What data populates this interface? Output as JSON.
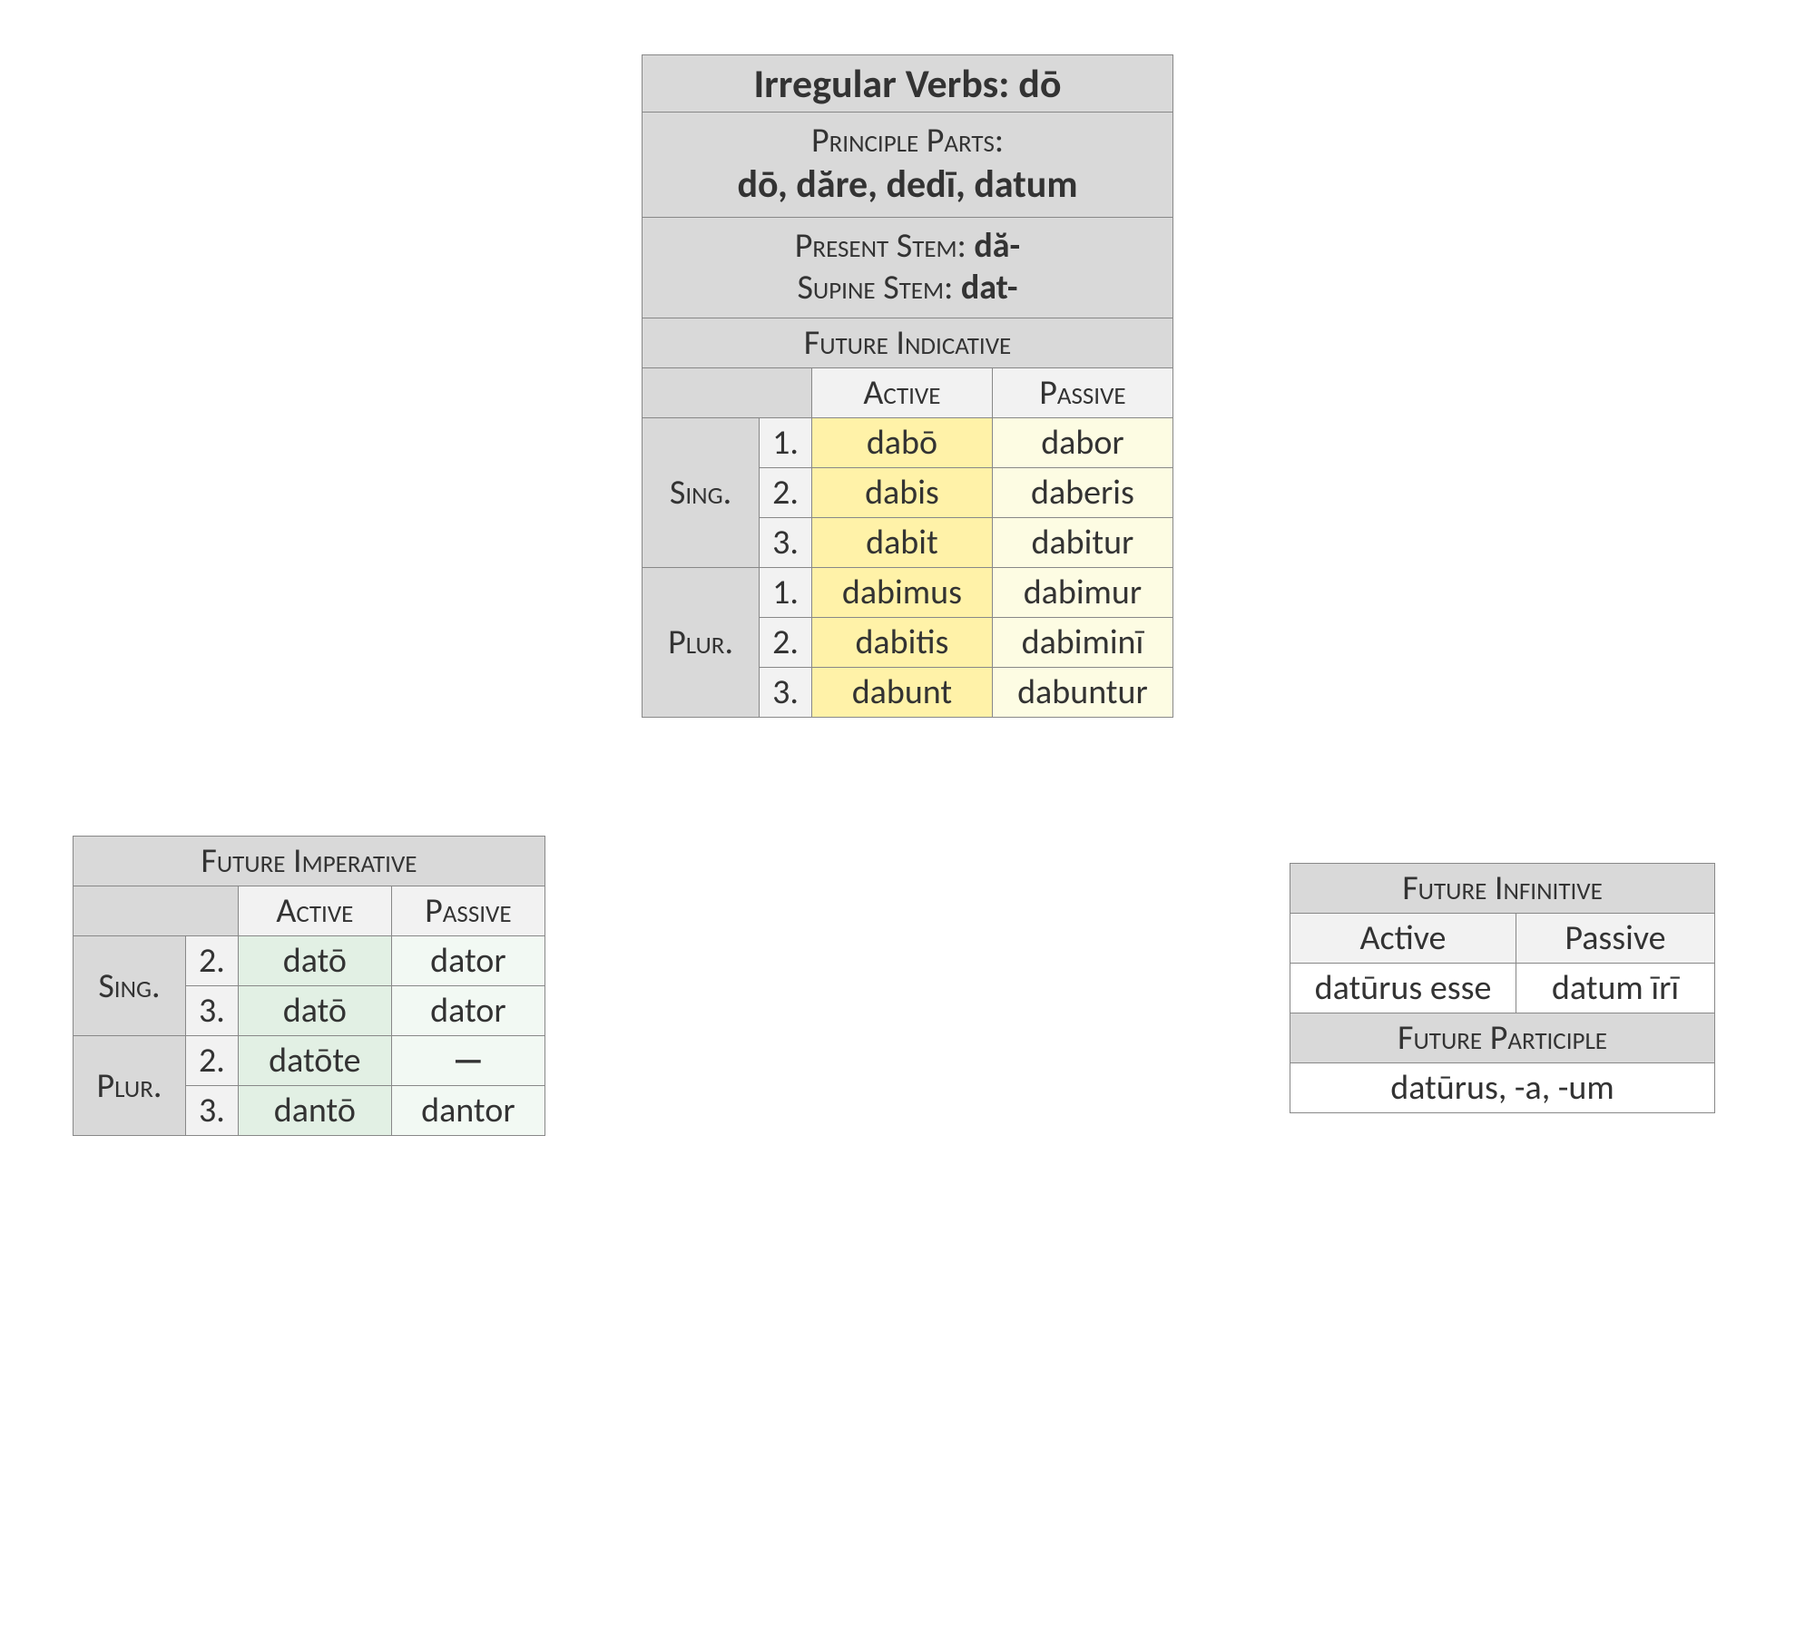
{
  "main": {
    "title": "Irregular Verbs: dō",
    "pp_label": "Principle Parts:",
    "pp_value": "dō, dăre, dedī, datum",
    "stem1_label": "Present Stem: ",
    "stem1_value": "dă-",
    "stem2_label": "Supine Stem: ",
    "stem2_value": "dat-",
    "tense": "Future Indicative",
    "col_active": "Active",
    "col_passive": "Passive",
    "sing": "Sing.",
    "plur": "Plur.",
    "p1": "1.",
    "p2": "2.",
    "p3": "3.",
    "forms": {
      "s1a": "dabō",
      "s1p": "dabor",
      "s2a": "dabis",
      "s2p": "daberis",
      "s3a": "dabit",
      "s3p": "dabitur",
      "p1a": "dabimus",
      "p1p": "dabimur",
      "p2a": "dabitis",
      "p2p": "dabiminī",
      "p3a": "dabunt",
      "p3p": "dabuntur"
    }
  },
  "imper": {
    "title": "Future Imperative",
    "col_active": "Active",
    "col_passive": "Passive",
    "sing": "Sing.",
    "plur": "Plur.",
    "p2": "2.",
    "p3": "3.",
    "s2a": "datō",
    "s2p": "dator",
    "s3a": "datō",
    "s3p": "dator",
    "p2a": "datōte",
    "p2p": "—",
    "p3a": "dantō",
    "p3p": "dantor"
  },
  "inf": {
    "title": "Future Infinitive",
    "col_active": "Active",
    "col_passive": "Passive",
    "act": "datūrus esse",
    "pas": "datum īrī",
    "part_title": "Future Participle",
    "part": "datūrus, -a, -um"
  }
}
